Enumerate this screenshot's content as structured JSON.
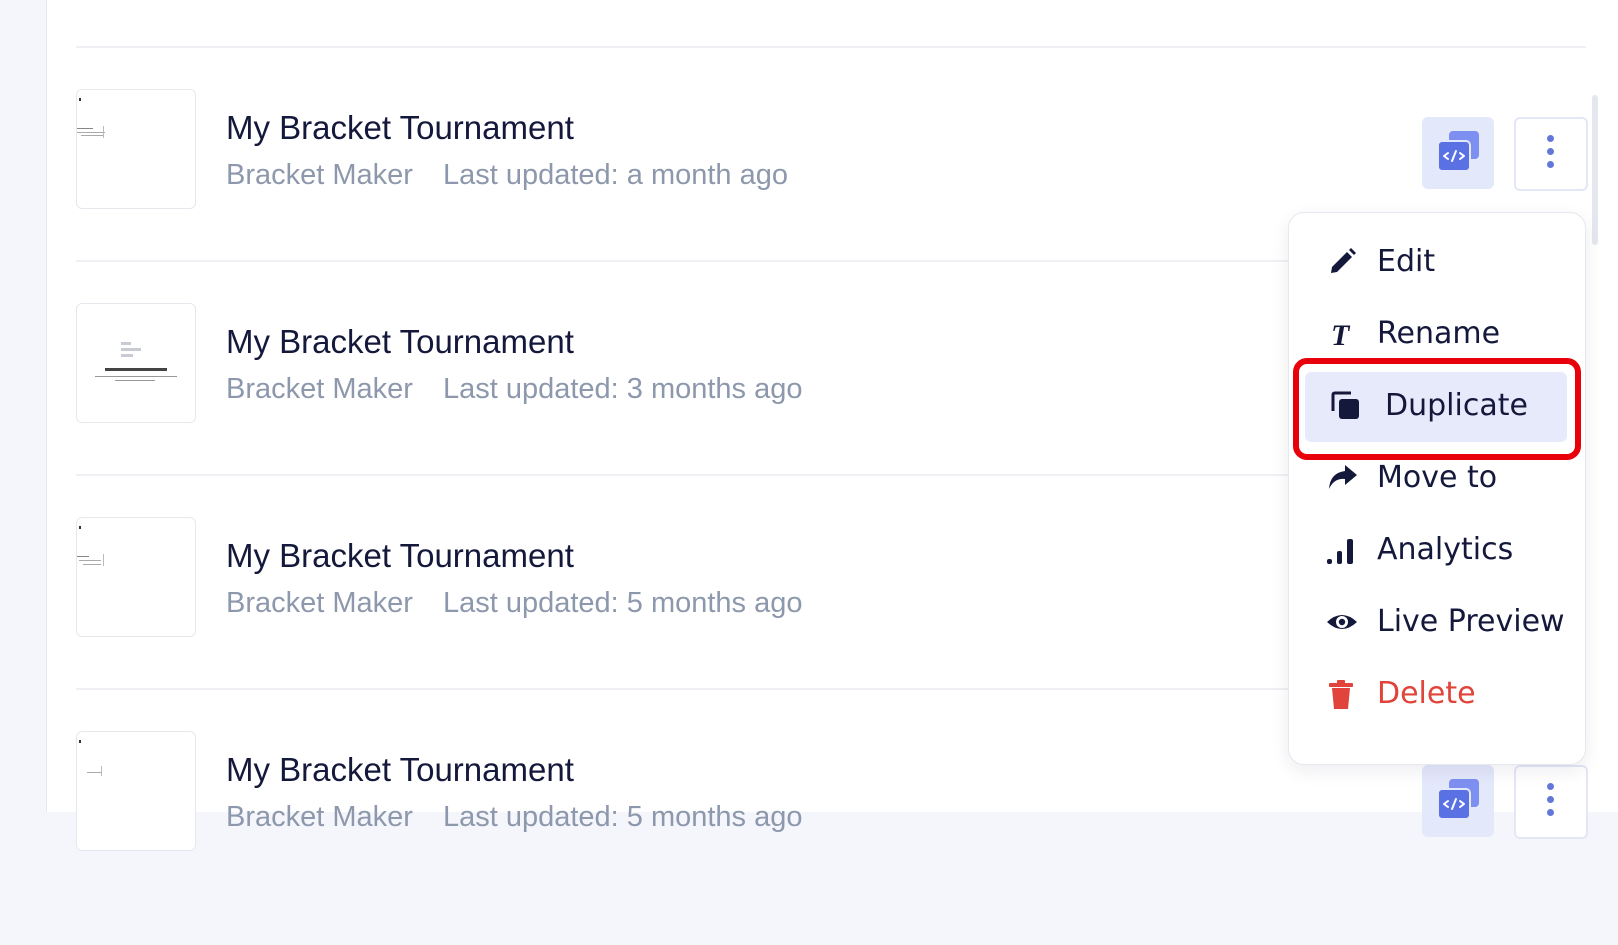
{
  "list": {
    "items": [
      {
        "title": "My Bracket Tournament",
        "type": "Bracket Maker",
        "updated": "Last updated: a month ago"
      },
      {
        "title": "My Bracket Tournament",
        "type": "Bracket Maker",
        "updated": "Last updated: 3 months ago"
      },
      {
        "title": "My Bracket Tournament",
        "type": "Bracket Maker",
        "updated": "Last updated: 5 months ago"
      },
      {
        "title": "My Bracket Tournament",
        "type": "Bracket Maker",
        "updated": "Last updated: 5 months ago"
      }
    ]
  },
  "menu": {
    "items": [
      {
        "label": "Edit",
        "icon": "pencil-icon"
      },
      {
        "label": "Rename",
        "icon": "text-t-icon"
      },
      {
        "label": "Duplicate",
        "icon": "duplicate-icon",
        "selected": true
      },
      {
        "label": "Move to",
        "icon": "share-arrow-icon"
      },
      {
        "label": "Analytics",
        "icon": "bar-chart-icon"
      },
      {
        "label": "Live Preview",
        "icon": "eye-icon"
      },
      {
        "label": "Delete",
        "icon": "trash-icon"
      }
    ]
  },
  "colors": {
    "title": "#14183b",
    "meta": "#8d98ac",
    "accent": "#6377d9",
    "accent_bg": "#e4e8fb",
    "danger": "#e0443a",
    "highlight_ring": "#e8000b"
  }
}
